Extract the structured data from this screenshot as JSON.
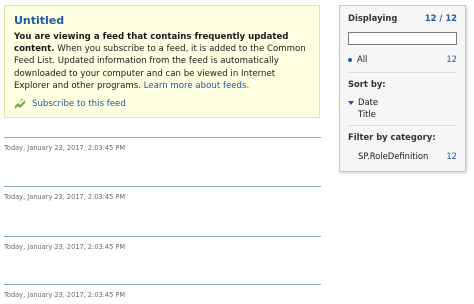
{
  "banner": {
    "title": "Untitled",
    "text_bold": "You are viewing a feed that contains frequently updated content.",
    "text_normal": " When you subscribe to a feed, it is added to the Common Feed List. Updated information from the feed is automatically downloaded to your computer and can be viewed in Internet Explorer and other programs. ",
    "learn_more": "Learn more about feeds.",
    "subscribe_label": "Subscribe to this feed"
  },
  "feed_items": [
    {
      "timestamp": "Today, January 23, 2017, 2:03:45 PM"
    },
    {
      "timestamp": "Today, January 23, 2017, 2:03:45 PM"
    },
    {
      "timestamp": "Today, January 23, 2017, 2:03:45 PM"
    },
    {
      "timestamp": "Today, January 23, 2017, 2:03:45 PM"
    }
  ],
  "panel": {
    "displaying_label": "Displaying",
    "displaying_count": "12 / 12",
    "search_value": "",
    "all_label": "All",
    "all_count": "12",
    "sort_by_label": "Sort by:",
    "sort_date": "Date",
    "sort_title": "Title",
    "filter_label": "Filter by category:",
    "category_label": "SP.RoleDefinition",
    "category_count": "12"
  },
  "colors": {
    "accent": "#1e5aa8",
    "banner_bg": "#ffffe1",
    "rule": "#8fa7bd"
  },
  "icons": {
    "subscribe": "feed-subscribe-icon",
    "sort_arrow": "sort-descending-icon"
  }
}
